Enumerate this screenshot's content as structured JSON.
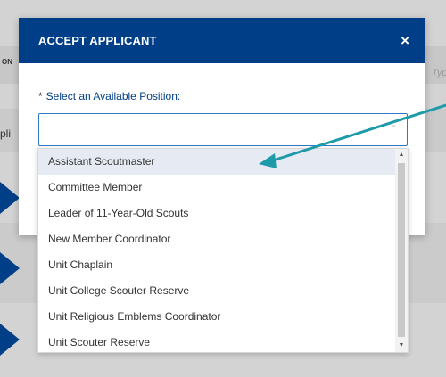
{
  "background": {
    "left_text_1": "ON",
    "left_text_2": "pli",
    "right_text": "Typ"
  },
  "modal": {
    "title": "ACCEPT APPLICANT",
    "close_glyph": "×",
    "field": {
      "required_mark": "*",
      "label": "Select an Available Position:",
      "value": "",
      "arrow_glyph": "⌃"
    }
  },
  "dropdown": {
    "options": [
      "Assistant Scoutmaster",
      "Committee Member",
      "Leader of 11-Year-Old Scouts",
      "New Member Coordinator",
      "Unit Chaplain",
      "Unit College Scouter Reserve",
      "Unit Religious Emblems Coordinator",
      "Unit Scouter Reserve"
    ],
    "highlighted_index": 0,
    "scroll_up_glyph": "▲",
    "scroll_down_glyph": "▼"
  },
  "colors": {
    "header_bg": "#003f87",
    "select_border": "#2e78c5",
    "highlight_bg": "#e6ebf3",
    "annotation_arrow": "#1f9aa8"
  },
  "icons": [
    "close-icon",
    "chevron-up-icon",
    "scroll-up-arrow-icon",
    "scroll-down-arrow-icon",
    "annotation-arrow-icon"
  ]
}
